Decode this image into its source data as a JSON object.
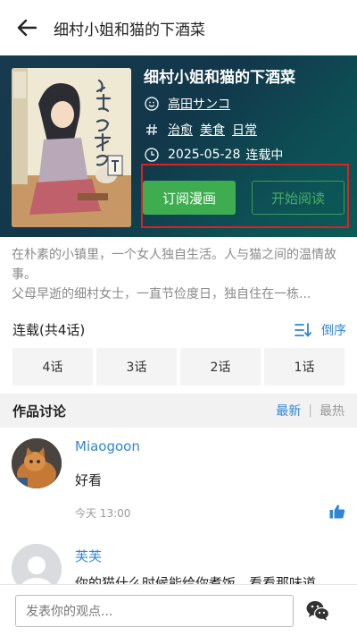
{
  "header": {
    "title": "细村小姐和猫的下酒菜"
  },
  "comic": {
    "title": "细村小姐和猫的下酒菜",
    "author": "高田サンコ",
    "tags": [
      "治愈",
      "美食",
      "日常"
    ],
    "date": "2025-05-28",
    "status": "连载中",
    "subscribe_label": "订阅漫画",
    "read_label": "开始阅读"
  },
  "description": {
    "line1": "在朴素的小镇里，一个女人独自生活。人与猫之间的温情故事。",
    "line2": "父母早逝的细村女士，一直节俭度日，独自住在一栋..."
  },
  "chapters": {
    "heading": "连载(共4话)",
    "sort_label": "倒序",
    "items": [
      "4话",
      "3话",
      "2话",
      "1话"
    ]
  },
  "discussion": {
    "heading": "作品讨论",
    "tab_latest": "最新",
    "separator": "|",
    "tab_hot": "最热",
    "comments": [
      {
        "user": "Miaogoon",
        "text": "好看",
        "time": "今天 13:00"
      },
      {
        "user": "芙芙",
        "text": "你的猫什么时候能给你煮饭，看看那味道"
      }
    ]
  },
  "input": {
    "placeholder": "发表你的观点..."
  },
  "colors": {
    "accent": "#2f86d6",
    "green": "#3ead4f",
    "highlight": "#e02020",
    "hero": "#12374a"
  },
  "icons": [
    "back-arrow-icon",
    "author-icon",
    "hash-icon",
    "clock-icon",
    "sort-icon",
    "thumbs-up-icon",
    "wechat-icon"
  ]
}
